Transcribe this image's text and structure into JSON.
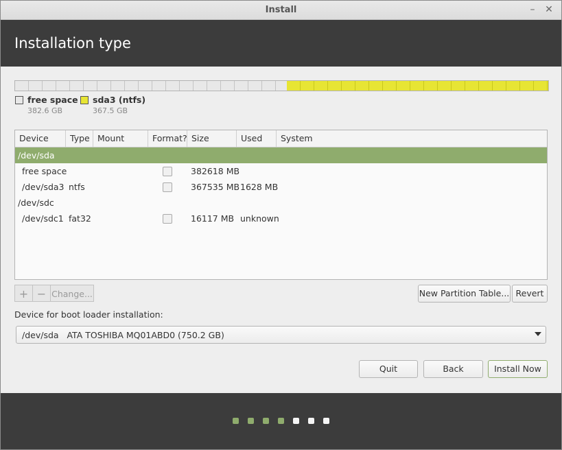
{
  "window": {
    "title": "Install",
    "minimize_icon": "minimize-icon",
    "close_icon": "close-icon",
    "minimize_glyph": "–",
    "close_glyph": "✕"
  },
  "header": {
    "title": "Installation type"
  },
  "disk": {
    "segments": [
      {
        "name": "free space",
        "size": "382.6 GB",
        "fraction": 0.51,
        "color": "#e8e8e8"
      },
      {
        "name": "sda3 (ntfs)",
        "size": "367.5 GB",
        "fraction": 0.49,
        "color": "#e7e534"
      }
    ]
  },
  "table": {
    "columns": [
      "Device",
      "Type",
      "Mount point",
      "Format?",
      "Size",
      "Used",
      "System"
    ],
    "rows": [
      {
        "device": "/dev/sda",
        "type": "",
        "mount": "",
        "format": null,
        "size": "",
        "used": "",
        "system": "",
        "selected": true,
        "indent": false
      },
      {
        "device": "free space",
        "type": "",
        "mount": "",
        "format": false,
        "size": "382618 MB",
        "used": "",
        "system": "",
        "selected": false,
        "indent": true
      },
      {
        "device": "/dev/sda3",
        "type": "ntfs",
        "mount": "",
        "format": false,
        "size": "367535 MB",
        "used": "1628 MB",
        "system": "",
        "selected": false,
        "indent": true
      },
      {
        "device": "/dev/sdc",
        "type": "",
        "mount": "",
        "format": null,
        "size": "",
        "used": "",
        "system": "",
        "selected": false,
        "indent": false
      },
      {
        "device": "/dev/sdc1",
        "type": "fat32",
        "mount": "",
        "format": false,
        "size": "16117 MB",
        "used": "unknown",
        "system": "",
        "selected": false,
        "indent": true
      }
    ]
  },
  "toolbar": {
    "add": "+",
    "remove": "−",
    "change": "Change...",
    "new_table": "New Partition Table...",
    "revert": "Revert"
  },
  "boot": {
    "label": "Device for boot loader installation:",
    "device": "/dev/sda   ATA TOSHIBA MQ01ABD0 (750.2 GB)"
  },
  "actions": {
    "quit": "Quit",
    "back": "Back",
    "install": "Install Now"
  },
  "progress": {
    "completed_steps": 4,
    "total_steps": 7
  },
  "colors": {
    "accent": "#8fac6d",
    "header_bg": "#3c3c3c",
    "ntfs_yellow": "#e7e534"
  }
}
